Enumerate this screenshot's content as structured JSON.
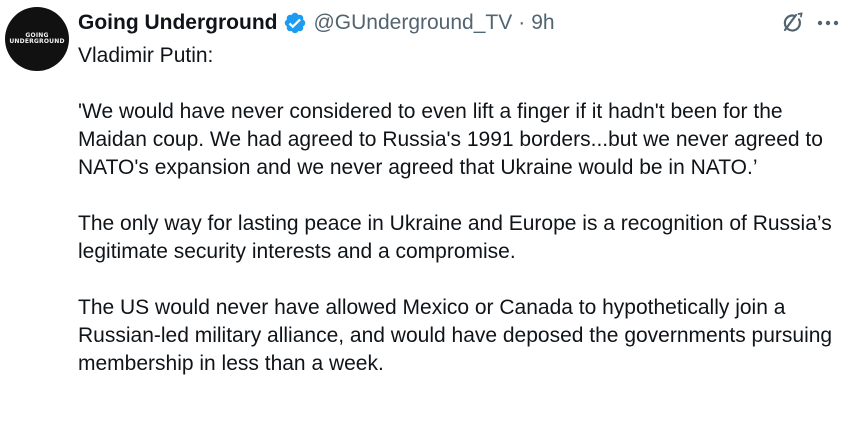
{
  "tweet": {
    "avatar_text": "GOING\nUNDERGROUND",
    "display_name": "Going Underground",
    "handle": "@GUnderground_TV",
    "separator": "·",
    "time": "9h",
    "paragraphs": [
      "Vladimir Putin:",
      "'We would have never considered to even lift a finger if it hadn't been for the Maidan coup. We had agreed to Russia's 1991 borders...but we never agreed to NATO's expansion and we never agreed that Ukraine would be in NATO.’",
      "The only way for lasting peace in Ukraine and Europe is a recognition of Russia’s legitimate security interests and a compromise.",
      "The US would never have allowed Mexico or Canada to hypothetically join a Russian-led military alliance, and would have deposed the governments pursuing membership in less than a week."
    ]
  },
  "colors": {
    "text": "#0f1419",
    "secondary": "#536471",
    "verified": "#1d9bf0",
    "avatar_bg": "#111111"
  },
  "icons": {
    "verified": "verified-badge-icon",
    "grok": "grok-icon",
    "more": "more-options-icon"
  }
}
